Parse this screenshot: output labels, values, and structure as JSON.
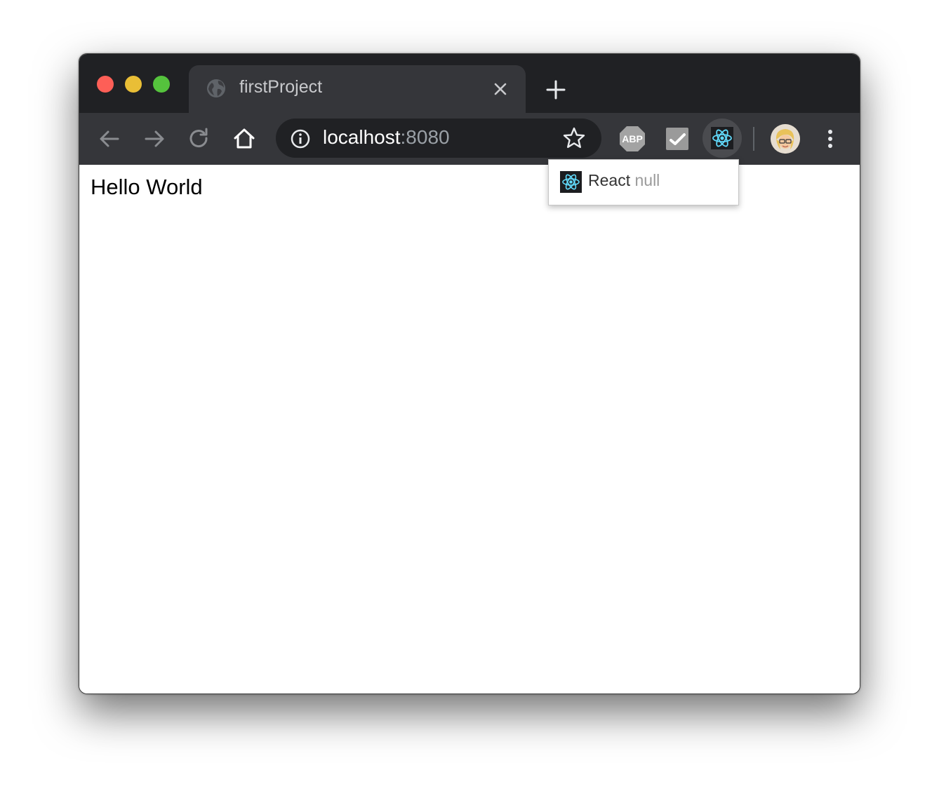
{
  "tab": {
    "title": "firstProject",
    "favicon": "globe-icon",
    "close_icon": "close-icon",
    "new_tab_icon": "plus-icon"
  },
  "toolbar": {
    "back_icon": "arrow-left-icon",
    "forward_icon": "arrow-right-icon",
    "reload_icon": "reload-icon",
    "home_icon": "home-icon",
    "menu_icon": "more-vertical-icon"
  },
  "omnibox": {
    "host": "localhost",
    "port": ":8080",
    "info_icon": "info-icon",
    "bookmark_icon": "star-icon"
  },
  "extensions": {
    "adblock_label": "ABP",
    "items": [
      "adblock-plus-icon",
      "checkmark-extension-icon",
      "react-devtools-icon"
    ],
    "avatar": "profile-avatar"
  },
  "page": {
    "heading": "Hello World"
  },
  "react_popup": {
    "label": "React",
    "value": "null"
  },
  "colors": {
    "tabstrip_bg": "#202124",
    "toolbar_bg": "#35363a",
    "react_accent": "#61dafb",
    "close_red": "#fd5f57",
    "minimize_yellow": "#e9be36",
    "maximize_green": "#55c33d"
  }
}
